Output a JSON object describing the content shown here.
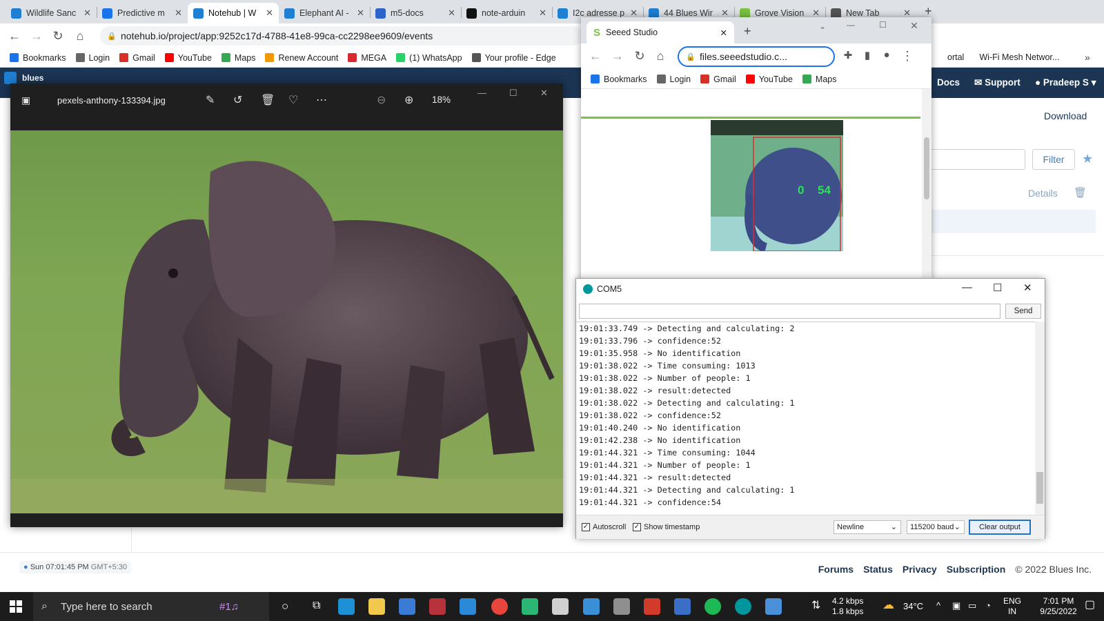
{
  "tabs": [
    {
      "label": "Wildlife Sanc",
      "color": "#1f7fd3"
    },
    {
      "label": "Predictive m",
      "color": "#1a73e8"
    },
    {
      "label": "Notehub | W",
      "color": "#1f7fd3",
      "active": true
    },
    {
      "label": "Elephant AI -",
      "color": "#1f7fd3"
    },
    {
      "label": "m5-docs",
      "color": "#2b63c9"
    },
    {
      "label": "note-arduin",
      "color": "#111"
    },
    {
      "label": "I2c adresse p",
      "color": "#1f7fd3"
    },
    {
      "label": "44 Blues Wir",
      "color": "#1f7fd3"
    },
    {
      "label": "Grove Vision",
      "color": "#7bc142"
    },
    {
      "label": "New Tab",
      "color": "#555"
    }
  ],
  "address": {
    "url": "notehub.io/project/app:9252c17d-4788-41e8-99ca-cc2298ee9609/events"
  },
  "bookmarks": [
    {
      "label": "Bookmarks",
      "color": "#1a73e8"
    },
    {
      "label": "Login",
      "color": "#666"
    },
    {
      "label": "Gmail",
      "color": "#d93025"
    },
    {
      "label": "YouTube",
      "color": "#ff0000"
    },
    {
      "label": "Maps",
      "color": "#34a853"
    },
    {
      "label": "Renew Account",
      "color": "#f29900"
    },
    {
      "label": "MEGA",
      "color": "#d9272e"
    },
    {
      "label": "(1) WhatsApp",
      "color": "#25d366"
    },
    {
      "label": "Your profile - Edge",
      "color": "#555"
    }
  ],
  "bookmarks_right": [
    {
      "label": "ortal"
    },
    {
      "label": "Wi-Fi Mesh Networ..."
    }
  ],
  "notehub": {
    "brand": "blues",
    "nav": {
      "docs": "Docs",
      "support": "Support",
      "user": "Pradeep S"
    },
    "download": "Download",
    "filter": "Filter",
    "details": "Details",
    "time": "Sun 07:01:45 PM",
    "tz": "GMT+5:30",
    "footer": {
      "forums": "Forums",
      "status": "Status",
      "privacy": "Privacy",
      "subscription": "Subscription",
      "copyright": "© 2022 Blues Inc."
    }
  },
  "viewer": {
    "filename": "pexels-anthony-133394.jpg",
    "zoom": "18%"
  },
  "chrome2": {
    "tab": "Seeed Studio",
    "url": "files.seeedstudio.c...",
    "bookmarks": [
      "Bookmarks",
      "Login",
      "Gmail",
      "YouTube",
      "Maps"
    ],
    "detection": {
      "label": "0",
      "score": "54"
    }
  },
  "serial": {
    "title": "COM5",
    "send": "Send",
    "lines": [
      "19:01:33.749 -> Detecting and calculating: 2",
      "19:01:33.796 -> confidence:52",
      "19:01:35.958 -> No identification",
      "19:01:38.022 -> Time consuming: 1013",
      "19:01:38.022 -> Number of people: 1",
      "19:01:38.022 -> result:detected",
      "19:01:38.022 -> Detecting and calculating: 1",
      "19:01:38.022 -> confidence:52",
      "19:01:40.240 -> No identification",
      "19:01:42.238 -> No identification",
      "19:01:44.321 -> Time consuming: 1044",
      "19:01:44.321 -> Number of people: 1",
      "19:01:44.321 -> result:detected",
      "19:01:44.321 -> Detecting and calculating: 1",
      "19:01:44.321 -> confidence:54"
    ],
    "autoscroll": "Autoscroll",
    "show_timestamp": "Show timestamp",
    "line_ending": "Newline",
    "baud": "115200 baud",
    "clear": "Clear output"
  },
  "taskbar": {
    "search": "Type here to search",
    "net_up": "4.2 kbps",
    "net_down": "1.8 kbps",
    "temp": "34°C",
    "lang1": "ENG",
    "lang2": "IN",
    "time": "7:01 PM",
    "date": "9/25/2022"
  }
}
